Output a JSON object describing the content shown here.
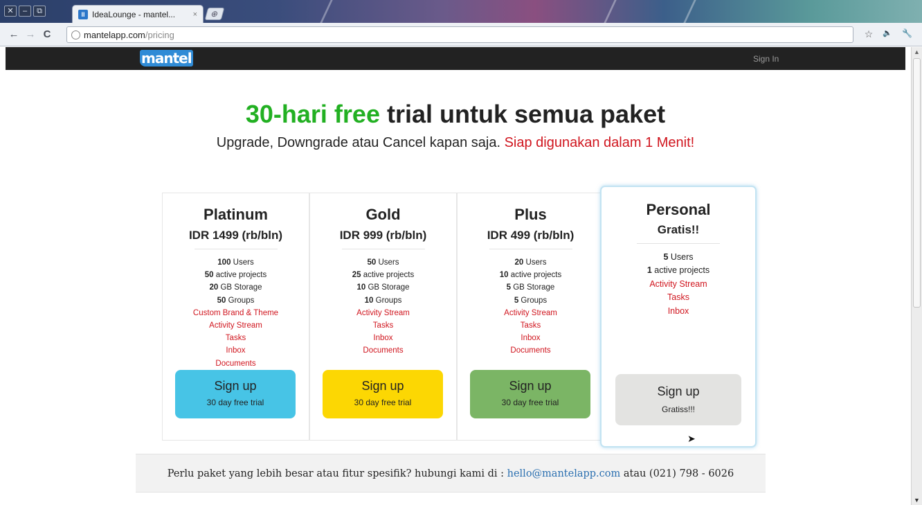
{
  "browser": {
    "window_buttons": [
      "✕",
      "–",
      "⧉"
    ],
    "tab": {
      "favicon": "II",
      "title": "IdeaLounge - mantel...",
      "close": "×"
    },
    "new_tab": "⊕",
    "nav": {
      "back": "←",
      "forward": "→",
      "reload": "C"
    },
    "url": {
      "host": "mantelapp.com",
      "path": "/pricing"
    },
    "toolbar_icons": {
      "star": "☆",
      "speaker": "🔈",
      "wrench": "🔧"
    }
  },
  "site": {
    "logo": "mantel",
    "signin": "Sign In"
  },
  "hero": {
    "title_highlight": "30-hari free",
    "title_rest": " trial untuk semua paket",
    "subtitle_plain": "Upgrade, Downgrade atau Cancel kapan saja. ",
    "subtitle_red": "Siap digunakan dalam 1 Menit!"
  },
  "plans": [
    {
      "name": "Platinum",
      "price": "IDR 1499 (rb/bln)",
      "stats": [
        [
          "100",
          " Users"
        ],
        [
          "50",
          " active projects"
        ],
        [
          "20",
          " GB Storage"
        ],
        [
          "50",
          " Groups"
        ]
      ],
      "features": [
        "Custom Brand & Theme",
        "Activity Stream",
        "Tasks",
        "Inbox",
        "Documents"
      ],
      "button": "Sign up",
      "button_sub": "30 day free trial",
      "button_color": "#47c4e6"
    },
    {
      "name": "Gold",
      "price": "IDR 999 (rb/bln)",
      "stats": [
        [
          "50",
          " Users"
        ],
        [
          "25",
          " active projects"
        ],
        [
          "10",
          " GB Storage"
        ],
        [
          "10",
          " Groups"
        ]
      ],
      "features": [
        "Activity Stream",
        "Tasks",
        "Inbox",
        "Documents"
      ],
      "button": "Sign up",
      "button_sub": "30 day free trial",
      "button_color": "#fcd703"
    },
    {
      "name": "Plus",
      "price": "IDR 499 (rb/bln)",
      "stats": [
        [
          "20",
          " Users"
        ],
        [
          "10",
          " active projects"
        ],
        [
          "5",
          " GB Storage"
        ],
        [
          "5",
          " Groups"
        ]
      ],
      "features": [
        "Activity Stream",
        "Tasks",
        "Inbox",
        "Documents"
      ],
      "button": "Sign up",
      "button_sub": "30 day free trial",
      "button_color": "#7bb565"
    },
    {
      "name": "Personal",
      "price": "Gratis!!",
      "stats": [
        [
          "5",
          " Users"
        ],
        [
          "1",
          " active projects"
        ]
      ],
      "features": [
        "Activity Stream",
        "Tasks",
        "Inbox"
      ],
      "button": "Sign up",
      "button_sub": "Gratiss!!!",
      "button_color": "#e3e3e1"
    }
  ],
  "contact": {
    "text": "Perlu paket yang lebih besar atau fitur spesifik? hubungi kami di : ",
    "email": "hello@mantelapp.com",
    "phone": " atau (021) 798 - 6026"
  }
}
